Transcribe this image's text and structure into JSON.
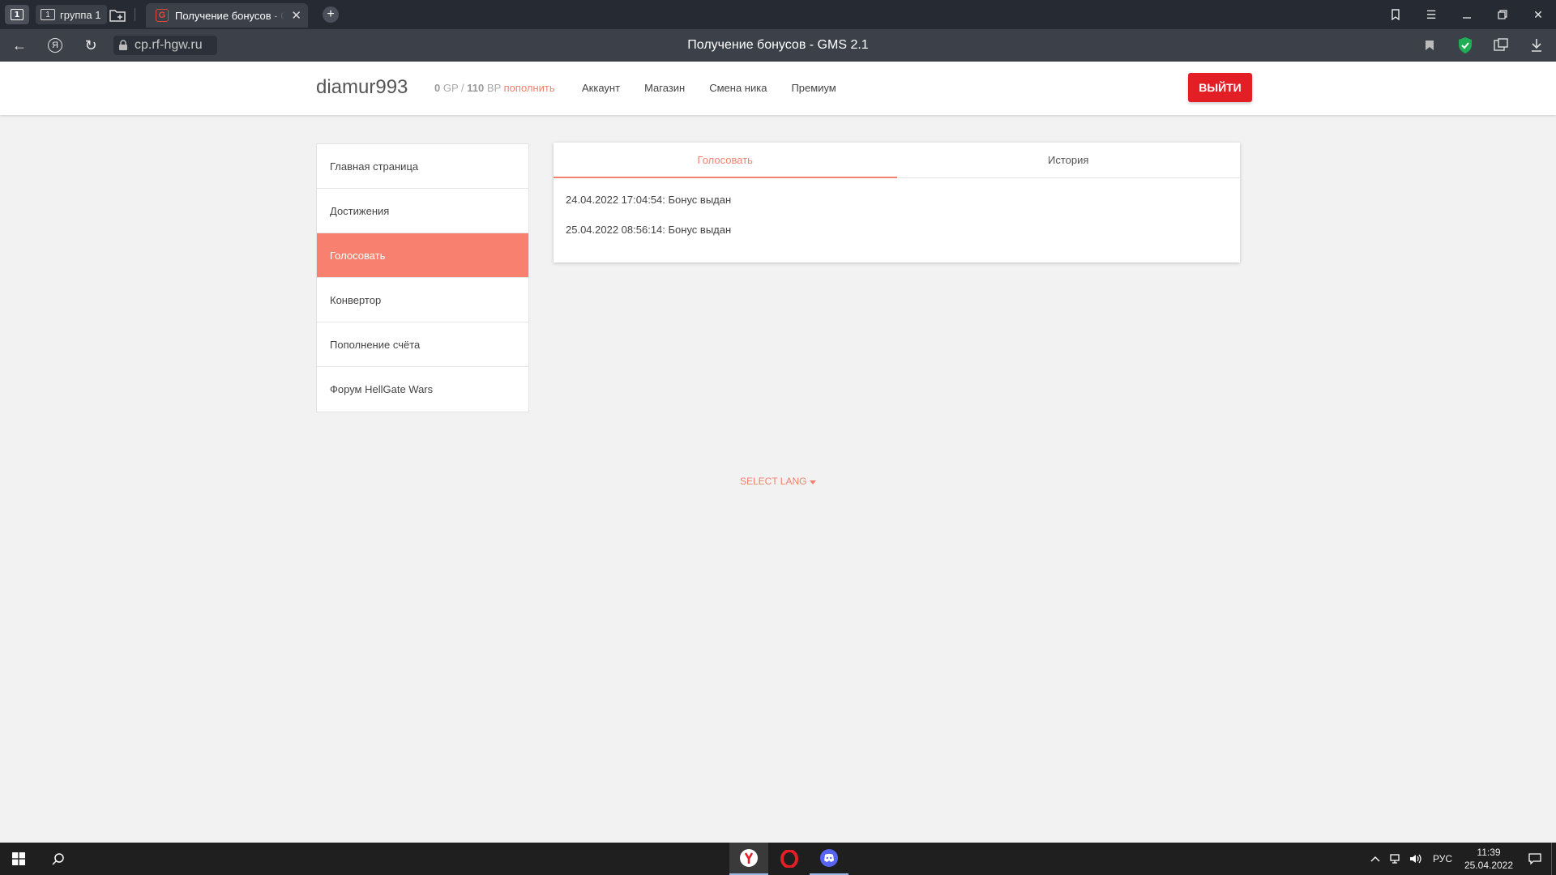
{
  "browser": {
    "tab_counter": "1",
    "group_tab": {
      "number": "1",
      "label": "группа 1"
    },
    "active_tab": {
      "favicon": "G",
      "title": "Получение бонусов - GMS 2.1",
      "close": "✕"
    },
    "new_tab": "+",
    "url": "cp.rf-hgw.ru",
    "page_title": "Получение бонусов - GMS 2.1",
    "yandex_glyph": "Я"
  },
  "header": {
    "username": "diamur993",
    "gp_value": "0",
    "gp_unit": "GP",
    "separator": "/",
    "bp_value": "110",
    "bp_unit": "BP",
    "topup_label": "пополнить",
    "nav": [
      "Аккаунт",
      "Магазин",
      "Смена ника",
      "Премиум"
    ],
    "logout_label": "ВЫЙТИ"
  },
  "sidebar": {
    "items": [
      {
        "label": "Главная страница",
        "active": false
      },
      {
        "label": "Достижения",
        "active": false
      },
      {
        "label": "Голосовать",
        "active": true
      },
      {
        "label": "Конвертор",
        "active": false
      },
      {
        "label": "Пополнение счёта",
        "active": false
      },
      {
        "label": "Форум HellGate Wars",
        "active": false
      }
    ]
  },
  "content": {
    "tabs": [
      {
        "label": "Голосовать",
        "active": true
      },
      {
        "label": "История",
        "active": false
      }
    ],
    "history": [
      "24.04.2022 17:04:54: Бонус выдан",
      "25.04.2022 08:56:14: Бонус выдан"
    ]
  },
  "footer": {
    "select_lang": "SELECT LANG"
  },
  "taskbar": {
    "lang": "РУС",
    "time": "11:39",
    "date": "25.04.2022"
  },
  "colors": {
    "accent": "#f0826f",
    "active_menu": "#f7806f",
    "logout": "#e31e24"
  }
}
